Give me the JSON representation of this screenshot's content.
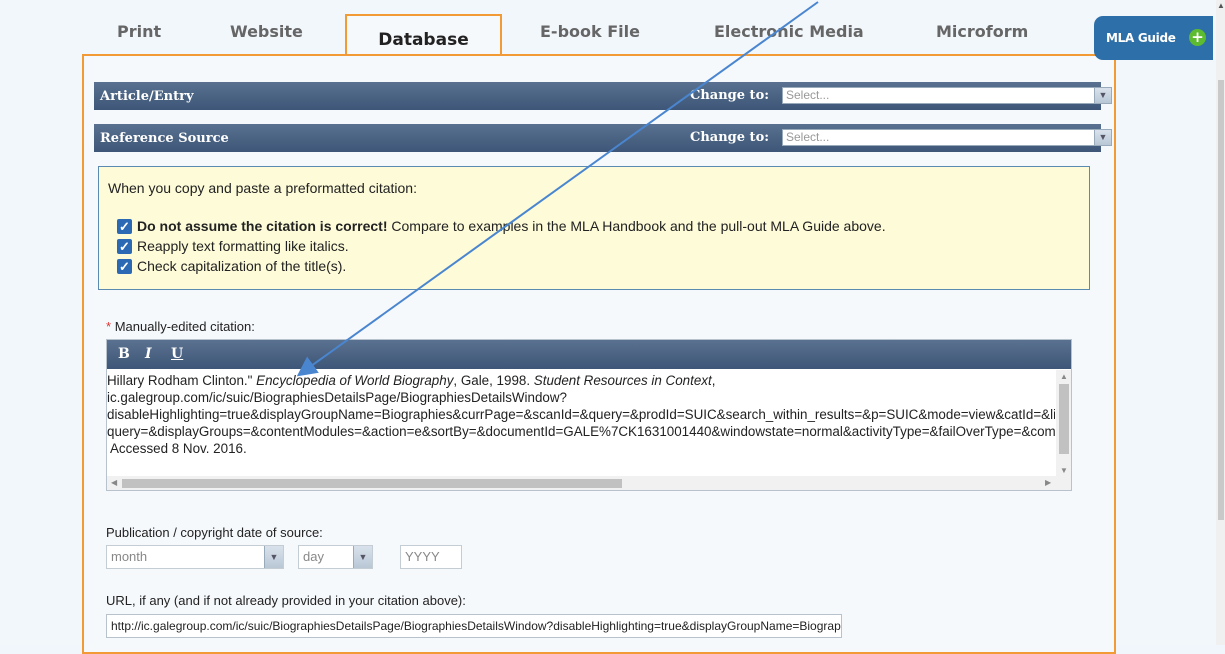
{
  "tabs": [
    {
      "label": "Print",
      "active": false
    },
    {
      "label": "Website",
      "active": false
    },
    {
      "label": "Database",
      "active": true
    },
    {
      "label": "E-book File",
      "active": false
    },
    {
      "label": "Electronic Media",
      "active": false
    },
    {
      "label": "Microform",
      "active": false
    }
  ],
  "mla_guide": {
    "label": "MLA Guide",
    "icon": "plus-circle-icon"
  },
  "sections": {
    "article": {
      "title": "Article/Entry",
      "change_label": "Change to:",
      "select_placeholder": "Select..."
    },
    "reference": {
      "title": "Reference Source",
      "change_label": "Change to:",
      "select_placeholder": "Select..."
    }
  },
  "notice": {
    "intro": "When you copy and paste a preformatted citation:",
    "item1_bold": "Do not assume the citation is correct!",
    "item1_rest": " Compare to examples in the MLA Handbook and the pull-out MLA Guide above.",
    "item2": "Reapply text formatting like italics.",
    "item3": "Check capitalization of the title(s)."
  },
  "citation": {
    "required_mark": "*",
    "label": "Manually-edited citation:",
    "toolbar": {
      "bold": "B",
      "italic": "I",
      "underline": "U"
    },
    "line1_a": "Hillary Rodham Clinton.\" ",
    "line1_italic1": "Encyclopedia of World Biography",
    "line1_b": ", Gale, 1998. ",
    "line1_italic2": "Student Resources in Context",
    "line1_c": ",",
    "line2": "ic.galegroup.com/ic/suic/BiographiesDetailsPage/BiographiesDetailsWindow?",
    "line3": "disableHighlighting=true&displayGroupName=Biographies&currPage=&scanId=&query=&prodId=SUIC&search_within_results=&p=SUIC&mode=view&catId=&limiter=&display-",
    "line4": "query=&displayGroups=&contentModules=&action=e&sortBy=&documentId=GALE%7CK1631001440&windowstate=normal&activityType=&failOverType=&commentary=",
    "line5": " Accessed 8 Nov. 2016."
  },
  "date": {
    "label": "Publication / copyright date of source:",
    "month": "month",
    "day": "day",
    "year_placeholder": "YYYY"
  },
  "url": {
    "label": "URL, if any (and if not already provided in your citation above):",
    "value": "http://ic.galegroup.com/ic/suic/BiographiesDetailsPage/BiographiesDetailsWindow?disableHighlighting=true&displayGroupName=Biographies"
  },
  "colors": {
    "tab_border": "#f29a35",
    "bar": "#4a6384",
    "notice_bg": "#fdfbd8",
    "checkbox": "#2c69b5",
    "arrow": "#4a86d0",
    "mla_guide": "#2d6fa8"
  }
}
